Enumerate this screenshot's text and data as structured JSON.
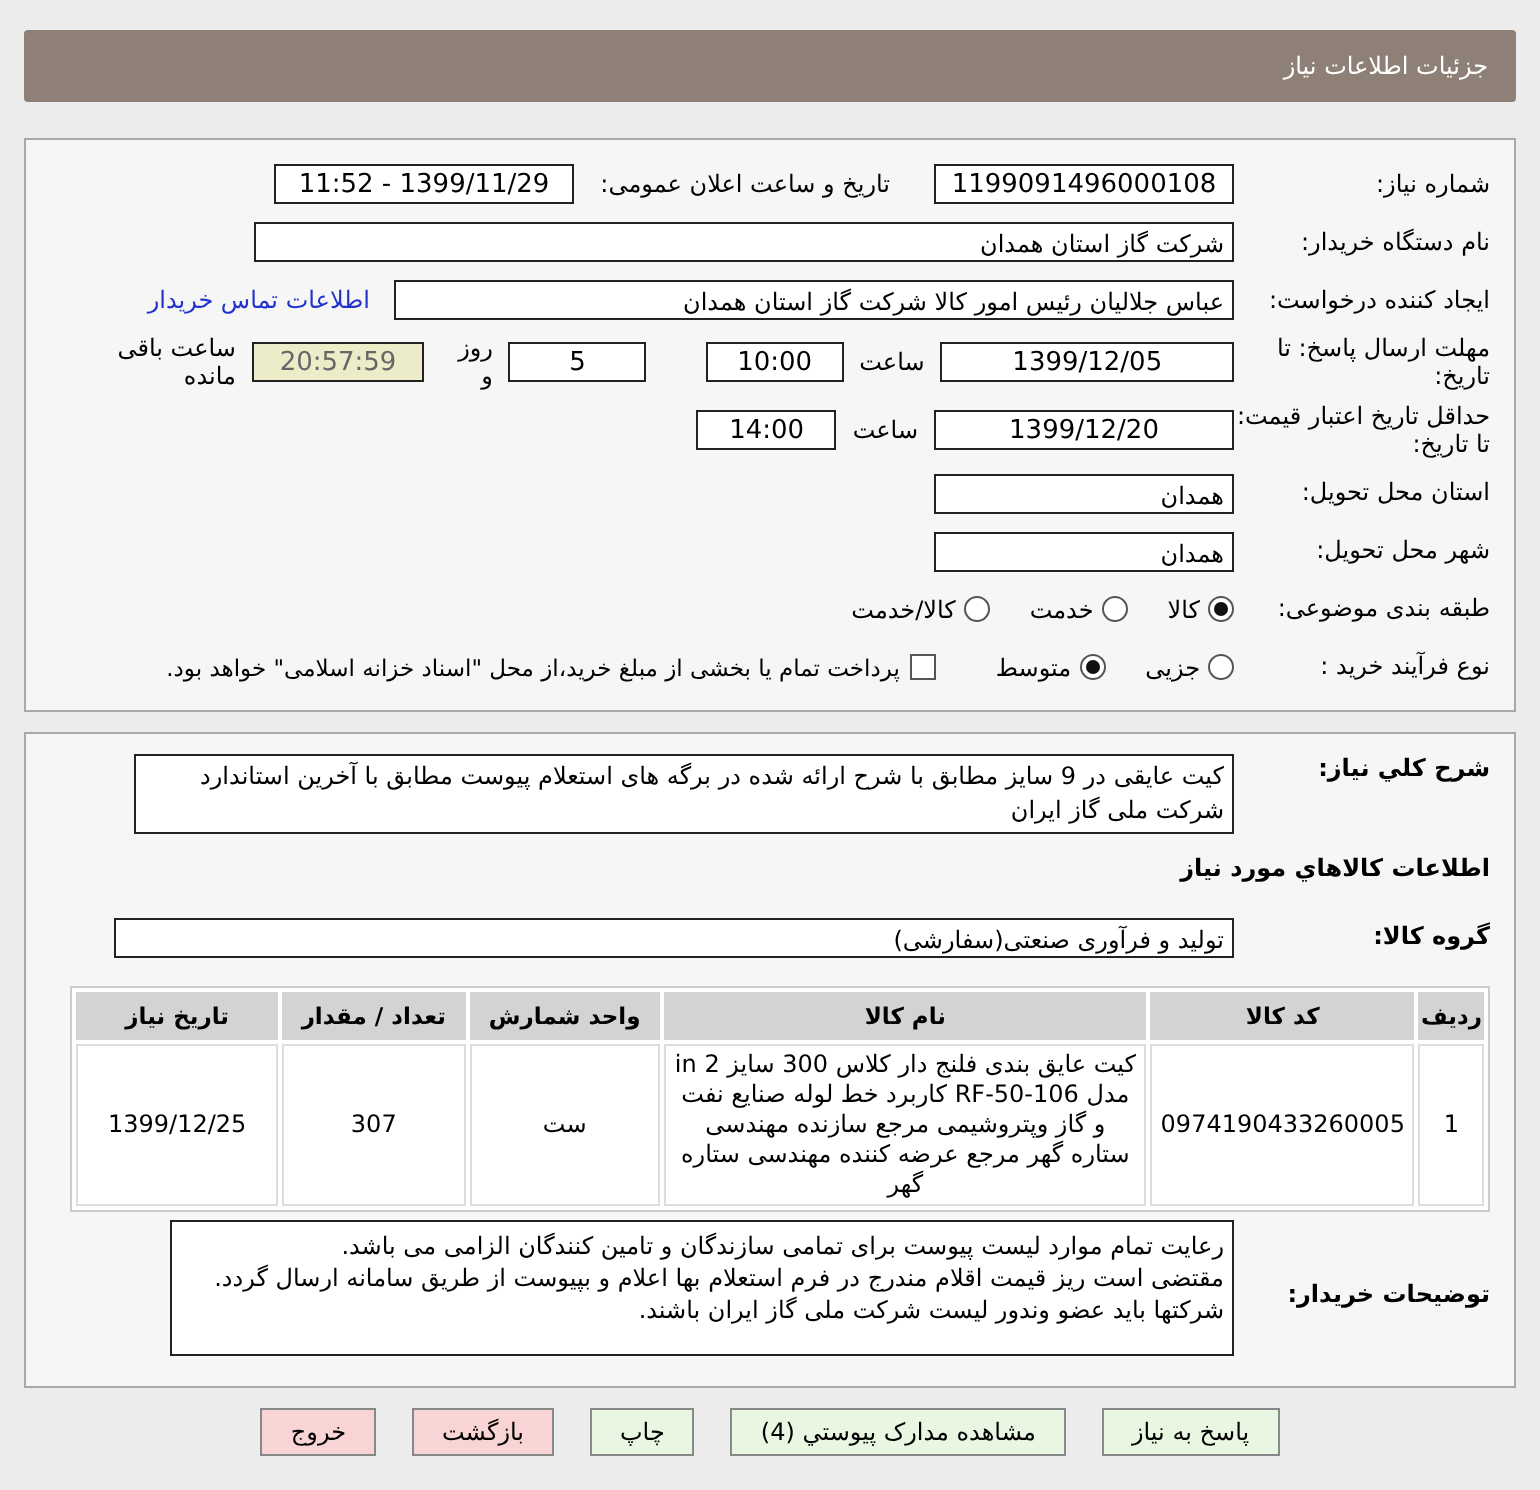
{
  "header": {
    "title": "جزئیات اطلاعات نیاز"
  },
  "details": {
    "need_number": {
      "label": "شماره نیاز:",
      "value": "1199091496000108"
    },
    "announce": {
      "label": "تاریخ و ساعت اعلان عمومی:",
      "value": "1399/11/29 - 11:52"
    },
    "buyer": {
      "label": "نام دستگاه خریدار:",
      "value": "شرکت گاز استان همدان"
    },
    "creator": {
      "label": "ایجاد کننده درخواست:",
      "value": "عباس جلالیان رئیس امور کالا شرکت گاز استان همدان",
      "link": "اطلاعات تماس خریدار"
    },
    "deadline": {
      "label": "مهلت ارسال پاسخ: تا تاریخ:",
      "date": "1399/12/05",
      "time_label": "ساعت",
      "time": "10:00",
      "days": "5",
      "days_label": "روز و",
      "remaining": "20:57:59",
      "remaining_label": "ساعت باقی مانده"
    },
    "validity": {
      "label": "حداقل تاریخ اعتبار قیمت: تا تاریخ:",
      "date": "1399/12/20",
      "time_label": "ساعت",
      "time": "14:00"
    },
    "province": {
      "label": "استان محل تحویل:",
      "value": "همدان"
    },
    "city": {
      "label": "شهر محل تحویل:",
      "value": "همدان"
    },
    "category": {
      "label": "طبقه بندی موضوعی:",
      "options": [
        {
          "label": "کالا",
          "selected": true
        },
        {
          "label": "خدمت",
          "selected": false
        },
        {
          "label": "کالا/خدمت",
          "selected": false
        }
      ]
    },
    "process": {
      "label": "نوع فرآیند خرید :",
      "options": [
        {
          "label": "جزیی",
          "selected": false
        },
        {
          "label": "متوسط",
          "selected": true
        }
      ],
      "checkbox": {
        "label": "پرداخت تمام یا بخشی از مبلغ خرید،از محل \"اسناد خزانه اسلامی\" خواهد بود.",
        "checked": false
      }
    }
  },
  "needs": {
    "description": {
      "label": "شرح کلي نیاز:",
      "value": "کیت عایقی در 9 سایز  مطابق با شرح ارائه شده در برگه های  استعلام پیوست مطابق با آخرین استاندارد شرکت ملی گاز ایران"
    },
    "section_title": "اطلاعات کالاهاي مورد نیاز",
    "group": {
      "label": "گروه کالا:",
      "value": "تولید و فرآوری صنعتی(سفارشی)"
    },
    "table": {
      "columns": [
        "ردیف",
        "کد کالا",
        "نام کالا",
        "واحد شمارش",
        "تعداد / مقدار",
        "تاریخ نیاز"
      ],
      "rows": [
        [
          "1",
          "0974190433260005",
          "کیت عایق بندی فلنج دار کلاس 300 سایز 2 in مدل RF-50-106 کاربرد خط لوله صنایع نفت و گاز وپتروشیمی مرجع سازنده مهندسی ستاره گهر مرجع عرضه کننده مهندسی ستاره گهر",
          "ست",
          "307",
          "1399/12/25"
        ]
      ]
    },
    "notes": {
      "label": "توضیحات خریدار:",
      "lines": [
        "رعایت تمام موارد لیست پیوست برای تمامی سازندگان و تامین کنندگان الزامی می باشد.",
        "مقتضی است ریز قیمت اقلام مندرج در فرم استعلام بها اعلام و بپیوست از طریق سامانه ارسال گردد.",
        "شرکتها باید عضو وندور لیست شرکت ملی گاز  ایران باشند."
      ]
    }
  },
  "buttons": [
    {
      "label": "پاسخ به نیاز",
      "kind": "normal"
    },
    {
      "label": "مشاهده مدارک پیوستي (4)",
      "kind": "normal"
    },
    {
      "label": "چاپ",
      "kind": "normal"
    },
    {
      "label": "بازگشت",
      "kind": "danger"
    },
    {
      "label": "خروج",
      "kind": "danger"
    }
  ]
}
